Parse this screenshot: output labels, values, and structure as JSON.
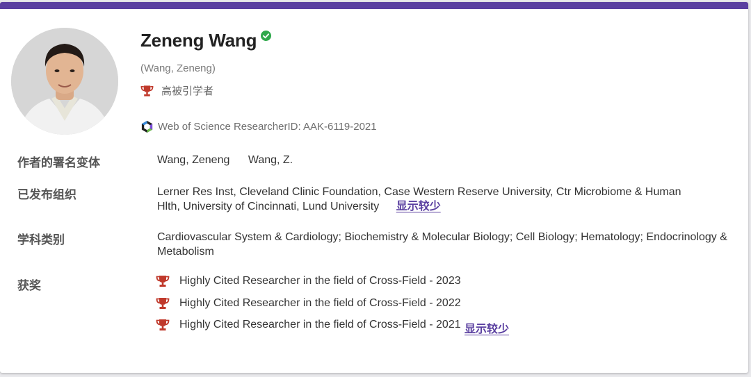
{
  "profile": {
    "name": "Zeneng Wang",
    "alt_name": "(Wang, Zeneng)",
    "highly_cited_label": "高被引学者",
    "researcher_id_label": "Web of Science ResearcherID: AAK-6119-2021"
  },
  "sections": {
    "variants": {
      "label": "作者的署名变体",
      "items": [
        "Wang, Zeneng",
        "Wang, Z."
      ]
    },
    "organizations": {
      "label": "已发布组织",
      "items": [
        "Lerner Res Inst",
        "Cleveland Clinic Foundation",
        "Case Western Reserve University",
        "Ctr Microbiome & Human Hlth",
        "University of Cincinnati",
        "Lund University"
      ],
      "show_less": "显示较少"
    },
    "categories": {
      "label": "学科类别",
      "items": [
        "Cardiovascular System & Cardiology",
        "Biochemistry & Molecular Biology",
        "Cell Biology",
        "Hematology",
        "Endocrinology & Metabolism"
      ]
    },
    "awards": {
      "label": "获奖",
      "items": [
        "Highly Cited Researcher in the field of Cross-Field - 2023",
        "Highly Cited Researcher in the field of Cross-Field - 2022",
        "Highly Cited Researcher in the field of Cross-Field - 2021"
      ],
      "show_less": "显示较少"
    }
  },
  "colors": {
    "accent": "#5a3fa0",
    "trophy": "#c0392b",
    "verified": "#2ea84a"
  },
  "icons": {
    "verified": "verified-check-icon",
    "trophy": "trophy-icon",
    "wos": "web-of-science-logo-icon"
  }
}
